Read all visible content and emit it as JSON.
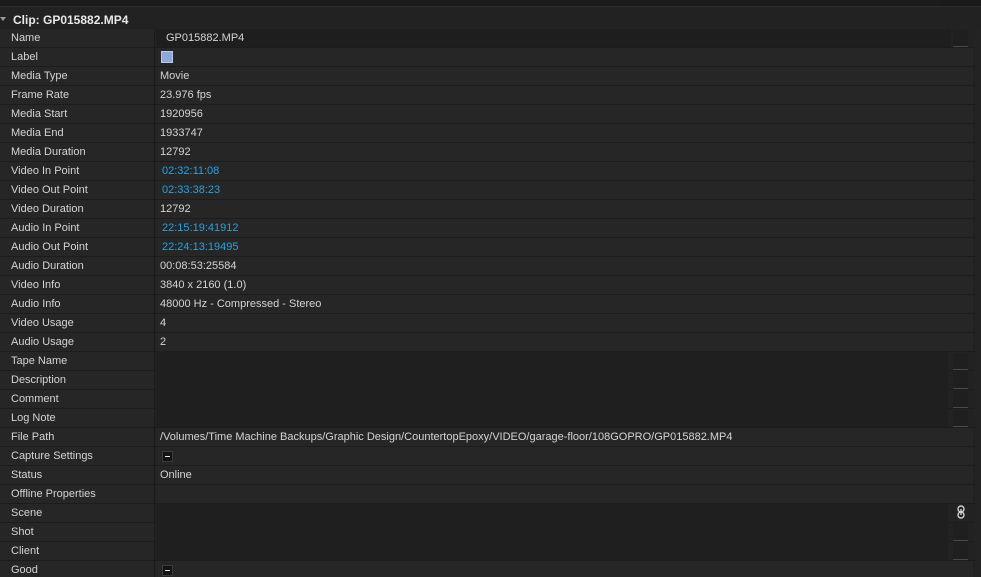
{
  "clip_header": {
    "title": "Clip: GP015882.MP4"
  },
  "fields": [
    {
      "key": "Name",
      "value": "GP015882.MP4",
      "kind": "edit"
    },
    {
      "key": "Label",
      "value": "",
      "kind": "swatch",
      "swatch_color": "#8fa8d8"
    },
    {
      "key": "Media Type",
      "value": "Movie",
      "kind": "text"
    },
    {
      "key": "Frame Rate",
      "value": "23.976 fps",
      "kind": "text"
    },
    {
      "key": "Media Start",
      "value": "1920956",
      "kind": "text"
    },
    {
      "key": "Media End",
      "value": "1933747",
      "kind": "text"
    },
    {
      "key": "Media Duration",
      "value": "12792",
      "kind": "text"
    },
    {
      "key": "Video In Point",
      "value": "02:32:11:08",
      "kind": "link"
    },
    {
      "key": "Video Out Point",
      "value": "02:33:38:23",
      "kind": "link"
    },
    {
      "key": "Video Duration",
      "value": "12792",
      "kind": "text"
    },
    {
      "key": "Audio In Point",
      "value": "22:15:19:41912",
      "kind": "link"
    },
    {
      "key": "Audio Out Point",
      "value": "22:24:13:19495",
      "kind": "link"
    },
    {
      "key": "Audio Duration",
      "value": "00:08:53:25584",
      "kind": "text"
    },
    {
      "key": "Video Info",
      "value": "3840 x 2160 (1.0)",
      "kind": "text"
    },
    {
      "key": "Audio Info",
      "value": "48000 Hz - Compressed - Stereo",
      "kind": "text"
    },
    {
      "key": "Video Usage",
      "value": "4",
      "kind": "text"
    },
    {
      "key": "Audio Usage",
      "value": "2",
      "kind": "text"
    },
    {
      "key": "Tape Name",
      "value": "",
      "kind": "block1"
    },
    {
      "key": "Description",
      "value": "",
      "kind": "block1"
    },
    {
      "key": "Comment",
      "value": "",
      "kind": "block1"
    },
    {
      "key": "Log Note",
      "value": "",
      "kind": "block1"
    },
    {
      "key": "File Path",
      "value": "/Volumes/Time Machine Backups/Graphic Design/CountertopEpoxy/VIDEO/garage-floor/108GOPRO/GP015882.MP4",
      "kind": "text"
    },
    {
      "key": "Capture Settings",
      "value": "",
      "kind": "check"
    },
    {
      "key": "Status",
      "value": "Online",
      "kind": "text"
    },
    {
      "key": "Offline Properties",
      "value": "",
      "kind": "text"
    },
    {
      "key": "Scene",
      "value": "",
      "kind": "block2"
    },
    {
      "key": "Shot",
      "value": "",
      "kind": "block2"
    },
    {
      "key": "Client",
      "value": "",
      "kind": "block2"
    },
    {
      "key": "Good",
      "value": "",
      "kind": "check"
    }
  ],
  "icons": {
    "link": "chain-link-icon"
  },
  "colors": {
    "timecode_link": "#27a1e0",
    "label_swatch": "#8fa8d8"
  }
}
